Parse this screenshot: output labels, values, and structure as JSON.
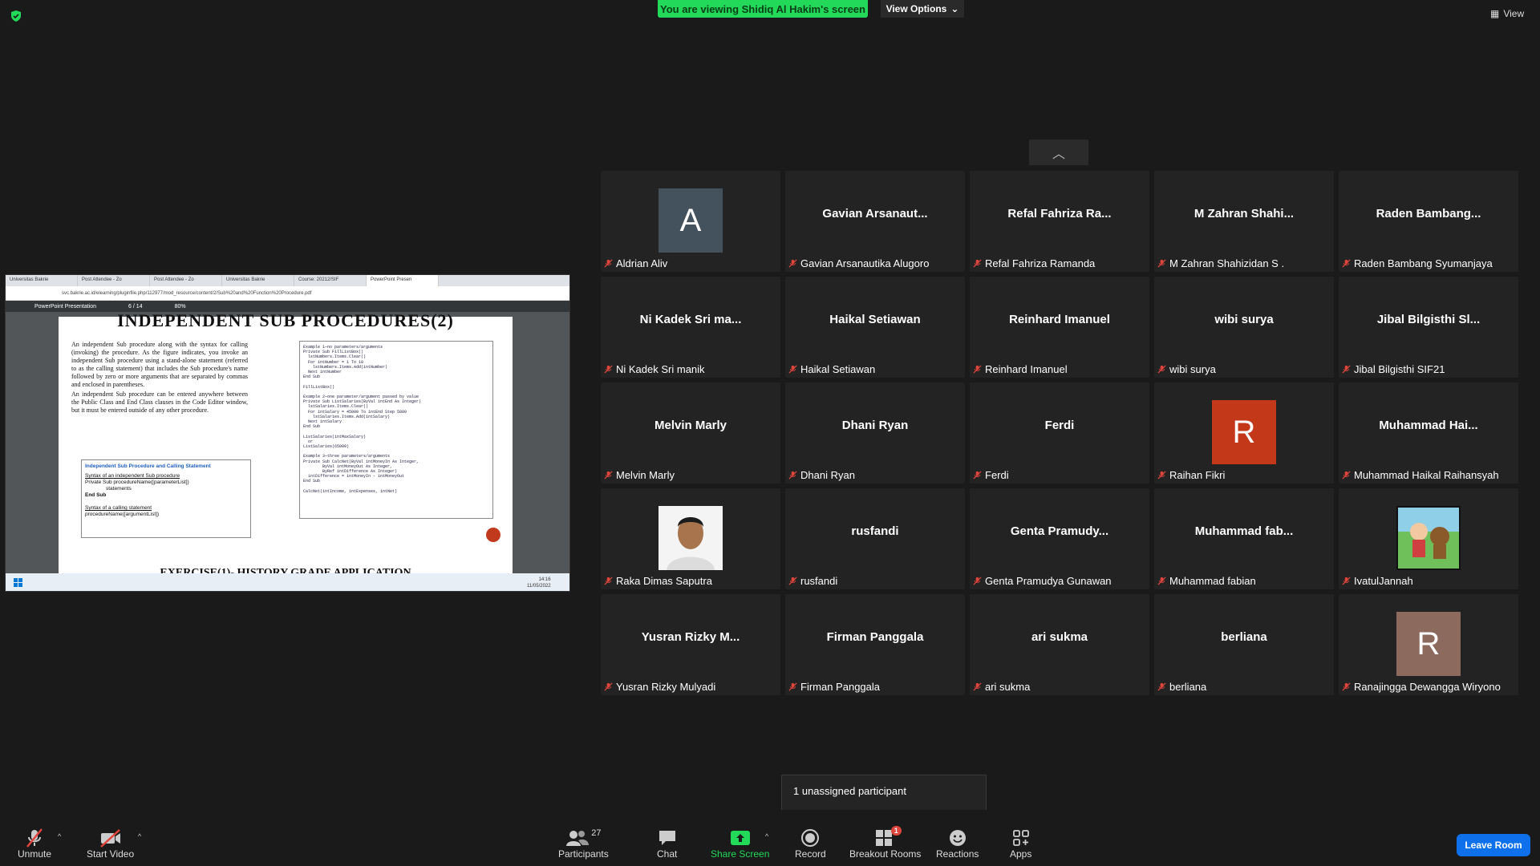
{
  "banner": {
    "text": "You are viewing Shidiq Al Hakim's screen"
  },
  "view_options": {
    "label": "View Options"
  },
  "top_right": {
    "view_label": "View"
  },
  "share": {
    "tabs": [
      "Universitas Bakrie",
      "Post Attendee - Zo",
      "Post Attendee - Zo",
      "Universitas Bakrie",
      "Course: 20212/SIF",
      "PowerPoint Presen"
    ],
    "url": "svc.bakrie.ac.id/elearning/pluginfile.php/112977/mod_resource/content/2/Sub%20and%20Function%20Procedure.pdf",
    "pdf_title": "PowerPoint Presentation",
    "page": "6",
    "pages": "/ 14",
    "zoom": "80%",
    "slide_title": "INDEPENDENT SUB PROCEDURES(2)",
    "bullet1": "An independent Sub procedure along with the syntax for calling (invoking) the procedure. As the figure indicates, you invoke an independent Sub procedure using a stand-alone statement (referred to as the calling statement) that includes the Sub procedure's name followed by zero or more arguments that are separated by commas and enclosed in parentheses.",
    "bullet2": "An independent Sub procedure can be entered anywhere between the Public Class and End Class clauses in the Code Editor window, but it must be entered outside of any other procedure.",
    "box_heading": "Independent Sub Procedure and Calling Statement",
    "box_syntax1": "Syntax of an independent Sub procedure",
    "box_line1": "Private Sub procedureName([parameterList])",
    "box_line2": "statements",
    "box_line3": "End Sub",
    "box_syntax2": "Syntax of a calling statement",
    "box_line4": "procedureName([argumentList])",
    "code": "Example 1—no parameters/arguments\nPrivate Sub FillListBox()\n  lstNumbers.Items.Clear()\n  For intNumber = 1 To 10\n    lstNumbers.Items.Add(intNumber)\n  Next intNumber\nEnd Sub\n\nFillListBox()\n\nExample 2—one parameter/argument passed by value\nPrivate Sub ListSalaries(ByVal intEnd As Integer)\n  lstSalaries.Items.Clear()\n  For intSalary = 45000 To intEnd Step 5000\n    lstSalaries.Items.Add(intSalary)\n  Next intSalary\nEnd Sub\n\nListSalaries(intMaxSalary)\n  or\nListSalaries(65000)\n\nExample 3—three parameters/arguments\nPrivate Sub CalcNet(ByVal intMoneyIn As Integer,\n        ByVal intMoneyOut As Integer,\n        ByRef intDifference As Integer)\n  intDifference = intMoneyIn - intMoneyOut\nEnd Sub\n\nCalcNet(intIncome, intExpenses, intNet)",
    "next_slide_title": "EXERCISE(1)- HISTORY GRADE APPLICATION",
    "clock_time": "14:16",
    "clock_date": "11/05/2022"
  },
  "participants": [
    {
      "name": "Aldrian Aliv",
      "display": "",
      "avatar": "A",
      "avatar_color": "#44525e"
    },
    {
      "name": "Gavian Arsanautika Alugoro",
      "display": "Gavian  Arsanaut..."
    },
    {
      "name": "Refal Fahriza Ramanda",
      "display": "Refal Fahriza Ra..."
    },
    {
      "name": "M Zahran Shahizidan S .",
      "display": "M Zahran  Shahi..."
    },
    {
      "name": "Raden Bambang Syumanjaya",
      "display": "Raden  Bambang..."
    },
    {
      "name": "Ni Kadek Sri manik",
      "display": "Ni Kadek Sri ma..."
    },
    {
      "name": "Haikal Setiawan",
      "display": "Haikal Setiawan"
    },
    {
      "name": "Reinhard Imanuel",
      "display": "Reinhard Imanuel"
    },
    {
      "name": "wibi surya",
      "display": "wibi surya"
    },
    {
      "name": "Jibal Bilgisthi SIF21",
      "display": "Jibal Bilgisthi Sl..."
    },
    {
      "name": "Melvin Marly",
      "display": "Melvin Marly"
    },
    {
      "name": "Dhani Ryan",
      "display": "Dhani Ryan"
    },
    {
      "name": "Ferdi",
      "display": "Ferdi"
    },
    {
      "name": "Raihan Fikri",
      "display": "",
      "avatar": "R",
      "avatar_color": "#c4381a"
    },
    {
      "name": "Muhammad Haikal Raihansyah",
      "display": "Muhammad  Hai..."
    },
    {
      "name": "Raka Dimas Saputra",
      "display": "",
      "avatar": "photo"
    },
    {
      "name": "rusfandi",
      "display": "rusfandi"
    },
    {
      "name": "Genta Pramudya Gunawan",
      "display": "Genta  Pramudy..."
    },
    {
      "name": "Muhammad fabian",
      "display": "Muhammad  fab..."
    },
    {
      "name": "IvatulJannah",
      "display": "",
      "avatar": "cartoon"
    },
    {
      "name": "Yusran Rizky Mulyadi",
      "display": "Yusran  Rizky  M..."
    },
    {
      "name": "Firman Panggala",
      "display": "Firman Panggala"
    },
    {
      "name": "ari sukma",
      "display": "ari sukma"
    },
    {
      "name": "berliana",
      "display": "berliana"
    },
    {
      "name": "Ranajingga Dewangga Wiryono",
      "display": "",
      "avatar": "R",
      "avatar_color": "#8c6a5e"
    }
  ],
  "tooltip": {
    "text": "1 unassigned participant"
  },
  "toolbar": {
    "unmute": "Unmute",
    "start_video": "Start Video",
    "participants": "Participants",
    "participants_count": "27",
    "chat": "Chat",
    "share_screen": "Share Screen",
    "record": "Record",
    "breakout_rooms": "Breakout Rooms",
    "breakout_badge": "1",
    "reactions": "Reactions",
    "apps": "Apps",
    "leave": "Leave Room"
  },
  "colors": {
    "share_green": "#23d959",
    "leave_blue": "#0e71eb",
    "muted_red": "#e0453c"
  }
}
